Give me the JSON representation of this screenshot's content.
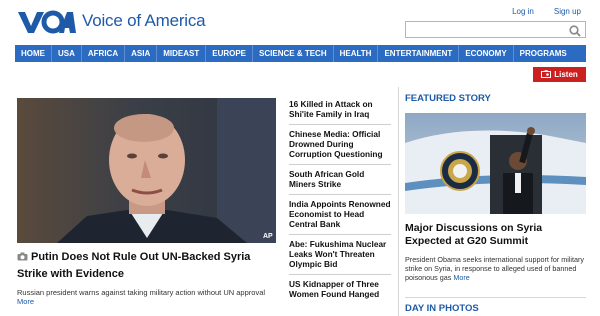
{
  "brand": {
    "name": "Voice of America"
  },
  "top_links": {
    "login": "Log in",
    "signup": "Sign up"
  },
  "search": {
    "placeholder": ""
  },
  "nav": [
    "HOME",
    "USA",
    "AFRICA",
    "ASIA",
    "MIDEAST",
    "EUROPE",
    "SCIENCE & TECH",
    "HEALTH",
    "ENTERTAINMENT",
    "ECONOMY",
    "PROGRAMS"
  ],
  "listen": {
    "label": "Listen",
    "icon": "radio-icon",
    "color": "#cc1f1f"
  },
  "main_story": {
    "title": "Putin Does Not Rule Out UN-Backed Syria Strike with Evidence",
    "summary": "Russian president warns against taking military action without UN approval",
    "more": "More",
    "photo_credit": "AP",
    "icon": "camera-icon"
  },
  "headlines": [
    "16 Killed in Attack on Shi'ite Family in Iraq",
    "Chinese Media: Official Drowned During Corruption Questioning",
    "South African Gold Miners Strike",
    "India Appoints Renowned Economist to Head Central Bank",
    "Abe: Fukushima Nuclear Leaks Won't Threaten Olympic Bid",
    "US Kidnapper of Three Women Found Hanged"
  ],
  "featured": {
    "section": "FEATURED STORY",
    "title": "Major Discussions on Syria Expected at G20 Summit",
    "summary": "President Obama seeks international support for military strike on Syria, in response to alleged used of banned poisonous gas",
    "more": "More"
  },
  "day_in_photos": {
    "section": "DAY IN PHOTOS"
  },
  "colors": {
    "brand_blue": "#1e5aa8",
    "nav_blue": "#2b6bc2",
    "listen_red": "#cc1f1f"
  }
}
